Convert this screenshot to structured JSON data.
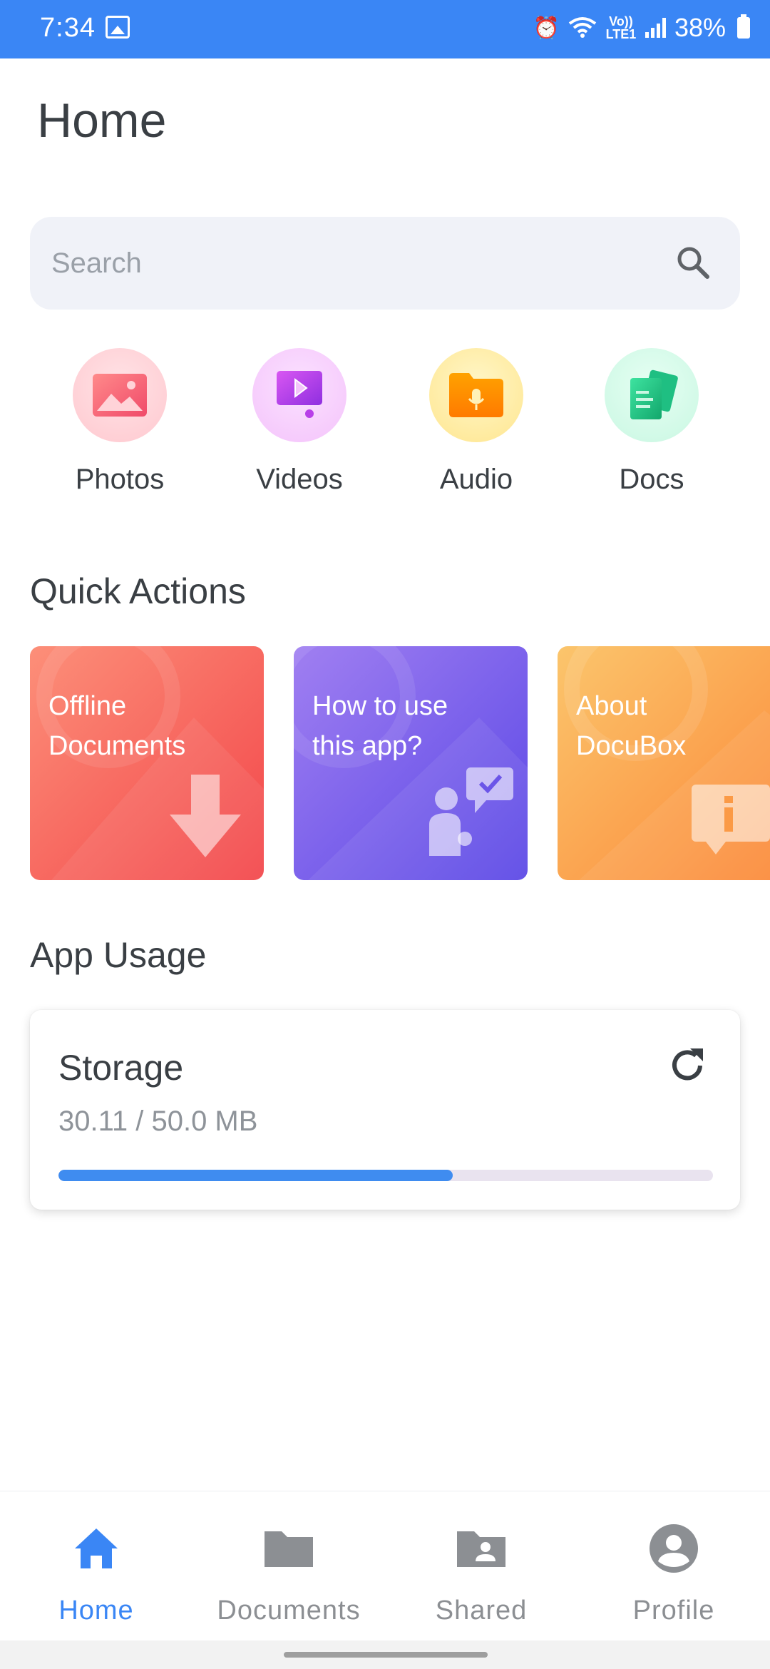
{
  "status_bar": {
    "time": "7:34",
    "battery": "38%",
    "network": "Vo)) LTE1"
  },
  "page": {
    "title": "Home"
  },
  "search": {
    "placeholder": "Search"
  },
  "categories": [
    {
      "label": "Photos",
      "icon": "photo-icon",
      "color": "#f36b6b"
    },
    {
      "label": "Videos",
      "icon": "video-icon",
      "color": "#c13de0"
    },
    {
      "label": "Audio",
      "icon": "audio-folder-icon",
      "color": "#f59a0c"
    },
    {
      "label": "Docs",
      "icon": "docs-icon",
      "color": "#23c486"
    }
  ],
  "quick_actions": {
    "title": "Quick Actions",
    "cards": [
      {
        "label": "Offline\nDocuments",
        "icon": "download-arrow-icon",
        "from": "#fb8b72",
        "to": "#f44a4a"
      },
      {
        "label": "How to use\nthis app?",
        "icon": "help-chat-icon",
        "from": "#9c7cf0",
        "to": "#5c48e4"
      },
      {
        "label": "About\nDocuBox",
        "icon": "info-icon",
        "from": "#fbc066",
        "to": "#fb8a3a"
      }
    ]
  },
  "app_usage": {
    "title": "App Usage",
    "storage": {
      "title": "Storage",
      "value": "30.11 / 50.0 MB",
      "used_fraction": 0.6022
    }
  },
  "bottom_nav": [
    {
      "label": "Home",
      "icon": "home-icon",
      "active": true
    },
    {
      "label": "Documents",
      "icon": "folder-icon",
      "active": false
    },
    {
      "label": "Shared",
      "icon": "shared-folder-icon",
      "active": false
    },
    {
      "label": "Profile",
      "icon": "profile-icon",
      "active": false
    }
  ],
  "colors": {
    "accent": "#3a86f5",
    "text": "#3a3f44",
    "muted": "#8c8f93"
  }
}
